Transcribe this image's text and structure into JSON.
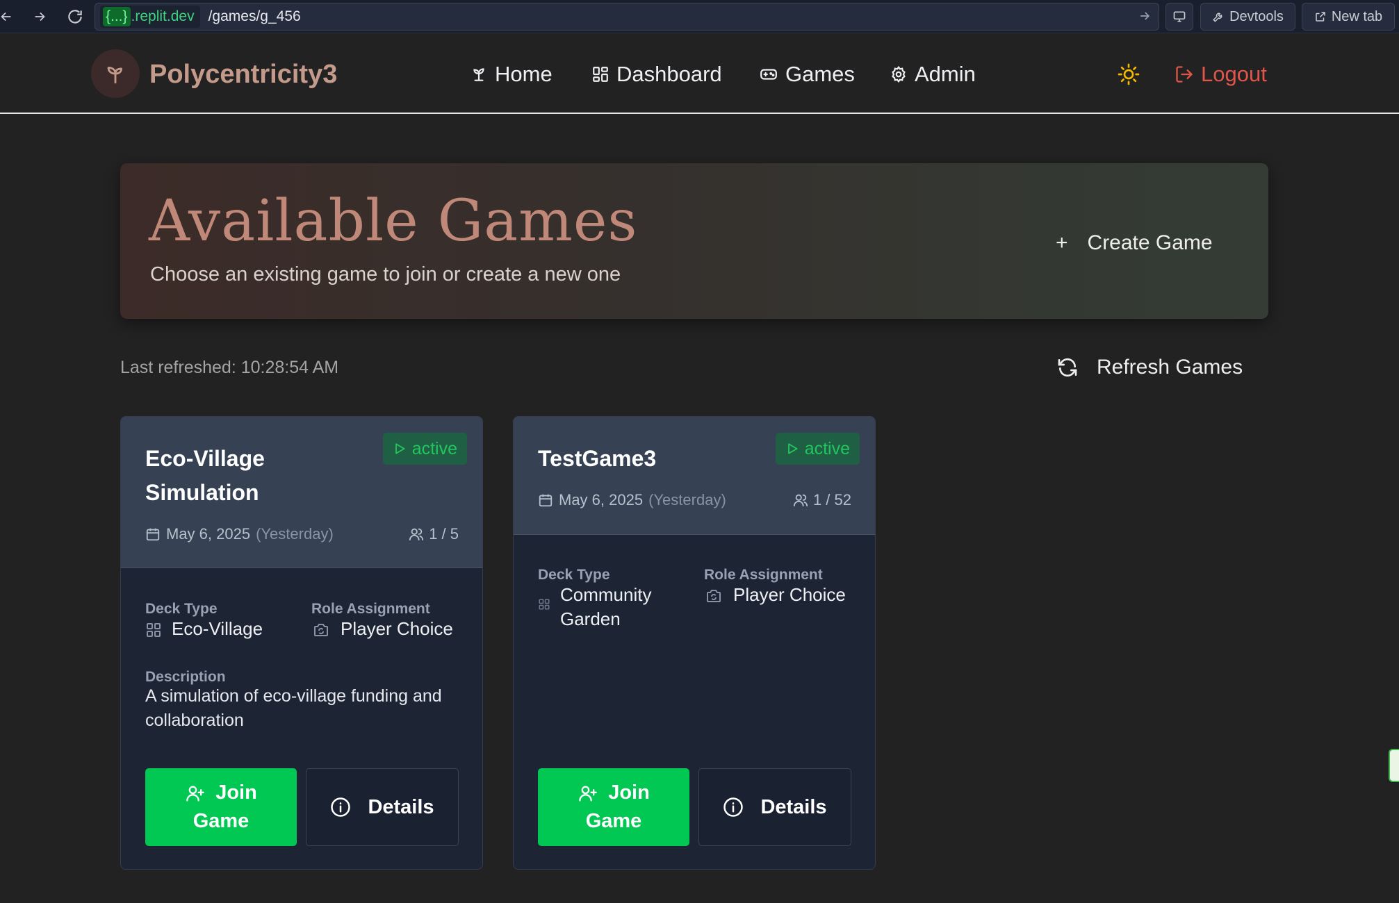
{
  "browser": {
    "url_host_brace": "{...}",
    "url_host": ".replit.dev",
    "url_path": "/games/g_456",
    "devtools_label": "Devtools",
    "new_tab_label": "New tab"
  },
  "header": {
    "brand": "Polycentricity3",
    "nav": [
      {
        "label": "Home",
        "icon": "sprout-icon"
      },
      {
        "label": "Dashboard",
        "icon": "grid-icon"
      },
      {
        "label": "Games",
        "icon": "gamepad-icon"
      },
      {
        "label": "Admin",
        "icon": "gear-icon"
      }
    ],
    "logout_label": "Logout",
    "theme_icon": "sun-icon"
  },
  "hero": {
    "title": "Available Games",
    "subtitle": "Choose an existing game to join or create a new one",
    "create_label": "Create Game",
    "create_icon": "+"
  },
  "toolbar": {
    "last_refreshed": "Last refreshed: 10:28:54 AM",
    "refresh_label": "Refresh Games"
  },
  "labels": {
    "deck_type": "Deck Type",
    "role_assignment": "Role Assignment",
    "description": "Description",
    "join_line1": "Join",
    "join_line2": "Game",
    "details": "Details"
  },
  "games": [
    {
      "title": "Eco-Village Simulation",
      "status": "active",
      "date": "May 6, 2025",
      "date_relative": "(Yesterday)",
      "players": "1 / 5",
      "deck_type": "Eco-Village",
      "role_assignment": "Player Choice",
      "description": "A simulation of eco-village funding and collaboration"
    },
    {
      "title": "TestGame3",
      "status": "active",
      "date": "May 6, 2025",
      "date_relative": "(Yesterday)",
      "players": "1 / 52",
      "deck_type": "Community Garden",
      "role_assignment": "Player Choice"
    }
  ],
  "colors": {
    "page_bg": "#222222",
    "brand": "#c49a8b",
    "hero_title": "#c08878",
    "logout": "#e2554a",
    "join_button": "#00c853",
    "status_active": "#22c55e",
    "card_bg": "#1d2535",
    "card_head_bg": "#364254"
  }
}
